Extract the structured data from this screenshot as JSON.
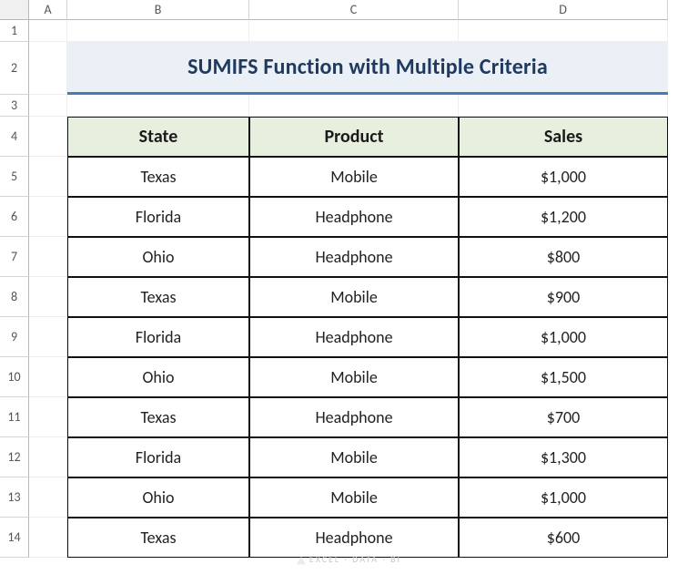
{
  "columns": [
    "A",
    "B",
    "C",
    "D"
  ],
  "rowNumbers": [
    "1",
    "2",
    "3",
    "4",
    "5",
    "6",
    "7",
    "8",
    "9",
    "10",
    "11",
    "12",
    "13",
    "14"
  ],
  "title": "SUMIFS Function with Multiple Criteria",
  "headers": {
    "state": "State",
    "product": "Product",
    "sales": "Sales"
  },
  "rows": [
    {
      "state": "Texas",
      "product": "Mobile",
      "sales": "$1,000"
    },
    {
      "state": "Florida",
      "product": "Headphone",
      "sales": "$1,200"
    },
    {
      "state": "Ohio",
      "product": "Headphone",
      "sales": "$800"
    },
    {
      "state": "Texas",
      "product": "Mobile",
      "sales": "$900"
    },
    {
      "state": "Florida",
      "product": "Headphone",
      "sales": "$1,000"
    },
    {
      "state": "Ohio",
      "product": "Mobile",
      "sales": "$1,500"
    },
    {
      "state": "Texas",
      "product": "Headphone",
      "sales": "$700"
    },
    {
      "state": "Florida",
      "product": "Mobile",
      "sales": "$1,300"
    },
    {
      "state": "Ohio",
      "product": "Mobile",
      "sales": "$1,000"
    },
    {
      "state": "Texas",
      "product": "Headphone",
      "sales": "$600"
    }
  ],
  "watermark": "EXCEL · DATA · BI",
  "chart_data": {
    "type": "table",
    "title": "SUMIFS Function with Multiple Criteria",
    "columns": [
      "State",
      "Product",
      "Sales"
    ],
    "records": [
      [
        "Texas",
        "Mobile",
        1000
      ],
      [
        "Florida",
        "Headphone",
        1200
      ],
      [
        "Ohio",
        "Headphone",
        800
      ],
      [
        "Texas",
        "Mobile",
        900
      ],
      [
        "Florida",
        "Headphone",
        1000
      ],
      [
        "Ohio",
        "Mobile",
        1500
      ],
      [
        "Texas",
        "Headphone",
        700
      ],
      [
        "Florida",
        "Mobile",
        1300
      ],
      [
        "Ohio",
        "Mobile",
        1000
      ],
      [
        "Texas",
        "Headphone",
        600
      ]
    ]
  }
}
